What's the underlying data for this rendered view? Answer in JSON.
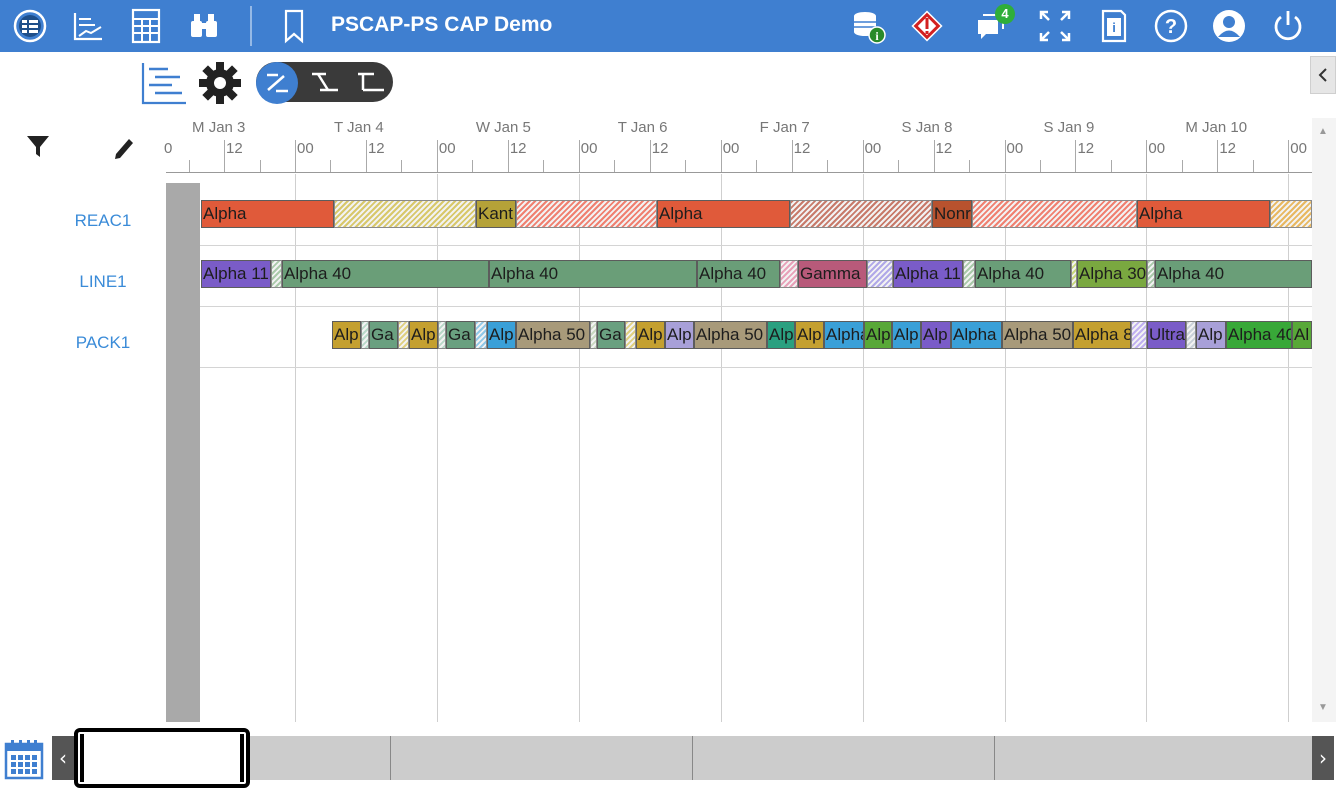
{
  "header": {
    "title": "PSCAP-PS CAP Demo",
    "notification_count": "4",
    "accent_color": "#3f7fd0"
  },
  "toolbar": {
    "icons": [
      "gantt-list-icon",
      "settings-gear-icon",
      "toggle-edit-icon",
      "link-mode-icon",
      "sequence-mode-icon"
    ]
  },
  "left_panel": {
    "filter_icon": "filter-icon",
    "edit_icon": "pencil-icon",
    "rows": [
      "REAC1",
      "LINE1",
      "PACK1"
    ]
  },
  "timeline": {
    "days": [
      "M Jan 3",
      "T Jan 4",
      "W Jan 5",
      "T Jan 6",
      "F Jan 7",
      "S Jan 8",
      "S Jan 9",
      "M Jan 10"
    ],
    "hour_labels": [
      "0",
      "12",
      "00",
      "12",
      "00",
      "12",
      "00",
      "12",
      "00",
      "12",
      "00",
      "12",
      "00",
      "12",
      "00",
      "12",
      "00"
    ]
  },
  "gantt": {
    "REAC1": [
      {
        "label": "Alpha",
        "color": "#e05a3a",
        "hatch": false
      },
      {
        "label": "",
        "color": "#d8c86a",
        "hatch": true
      },
      {
        "label": "Kant",
        "color": "#b5a238",
        "hatch": false
      },
      {
        "label": "",
        "color": "#f08070",
        "hatch": true
      },
      {
        "label": "Alpha",
        "color": "#e05a3a",
        "hatch": false
      },
      {
        "label": "",
        "color": "#c87a6a",
        "hatch": true
      },
      {
        "label": "Nonr",
        "color": "#b8522e",
        "hatch": false
      },
      {
        "label": "",
        "color": "#f08070",
        "hatch": true
      },
      {
        "label": "Alpha",
        "color": "#e05a3a",
        "hatch": false
      },
      {
        "label": "",
        "color": "#e8b860",
        "hatch": true
      }
    ],
    "LINE1": [
      {
        "label": "Alpha 11",
        "color": "#7a5cc8",
        "hatch": false
      },
      {
        "label": "",
        "color": "#a9c9a9",
        "hatch": true
      },
      {
        "label": "Alpha 40",
        "color": "#6a9e78",
        "hatch": false
      },
      {
        "label": "Alpha 40",
        "color": "#6a9e78",
        "hatch": false
      },
      {
        "label": "Alpha 40",
        "color": "#6a9e78",
        "hatch": false
      },
      {
        "label": "",
        "color": "#e8a0b8",
        "hatch": true
      },
      {
        "label": "Gamma",
        "color": "#b85a7a",
        "hatch": false
      },
      {
        "label": "",
        "color": "#b0a8e8",
        "hatch": true
      },
      {
        "label": "Alpha 11",
        "color": "#7a5cc8",
        "hatch": false
      },
      {
        "label": "",
        "color": "#a9c9a9",
        "hatch": true
      },
      {
        "label": "Alpha 40",
        "color": "#6a9e78",
        "hatch": false
      },
      {
        "label": "",
        "color": "#c8d87a",
        "hatch": true
      },
      {
        "label": "Alpha 30",
        "color": "#7aa840",
        "hatch": false
      },
      {
        "label": "",
        "color": "#a9c9a9",
        "hatch": true
      },
      {
        "label": "Alpha 40",
        "color": "#6a9e78",
        "hatch": false
      }
    ],
    "PACK1": [
      {
        "label": "Alp",
        "color": "#c4a030",
        "hatch": false
      },
      {
        "label": "",
        "color": "#b8d8c8",
        "hatch": true
      },
      {
        "label": "Ga",
        "color": "#6aa080",
        "hatch": false
      },
      {
        "label": "",
        "color": "#e0d080",
        "hatch": true
      },
      {
        "label": "Alp",
        "color": "#c4a030",
        "hatch": false
      },
      {
        "label": "",
        "color": "#b8d8c8",
        "hatch": true
      },
      {
        "label": "Ga",
        "color": "#6aa080",
        "hatch": false
      },
      {
        "label": "",
        "color": "#90c8e8",
        "hatch": true
      },
      {
        "label": "Alp",
        "color": "#3aa0d8",
        "hatch": false
      },
      {
        "label": "Alpha 50",
        "color": "#a89a7a",
        "hatch": false
      },
      {
        "label": "",
        "color": "#c8d8c0",
        "hatch": true
      },
      {
        "label": "Ga",
        "color": "#6aa080",
        "hatch": false
      },
      {
        "label": "",
        "color": "#e0d080",
        "hatch": true
      },
      {
        "label": "Alp",
        "color": "#c4a030",
        "hatch": false
      },
      {
        "label": "Alp",
        "color": "#a8a0d8",
        "hatch": false
      },
      {
        "label": "Alpha 50",
        "color": "#a89a7a",
        "hatch": false
      },
      {
        "label": "Alp",
        "color": "#2aa080",
        "hatch": false
      },
      {
        "label": "Alp",
        "color": "#c4a030",
        "hatch": false
      },
      {
        "label": "Alpha",
        "color": "#3aa0d8",
        "hatch": false
      },
      {
        "label": "Alp",
        "color": "#58a838",
        "hatch": false
      },
      {
        "label": "Alp",
        "color": "#3aa0d8",
        "hatch": false
      },
      {
        "label": "Alp",
        "color": "#7a5cc8",
        "hatch": false
      },
      {
        "label": "Alpha",
        "color": "#3aa0d8",
        "hatch": false
      },
      {
        "label": "Alpha 50",
        "color": "#a89a7a",
        "hatch": false
      },
      {
        "label": "Alpha 8",
        "color": "#c4a030",
        "hatch": false
      },
      {
        "label": "",
        "color": "#c0b0f0",
        "hatch": true
      },
      {
        "label": "Ultra",
        "color": "#7a5cc8",
        "hatch": false
      },
      {
        "label": "",
        "color": "#c8d0d8",
        "hatch": true
      },
      {
        "label": "Alp",
        "color": "#a8a0d8",
        "hatch": false
      },
      {
        "label": "Alpha 40",
        "color": "#38a838",
        "hatch": false
      },
      {
        "label": "Al",
        "color": "#58a838",
        "hatch": false
      }
    ]
  },
  "bottom": {
    "calendar_icon": "calendar-icon",
    "prev_icon": "chevron-left-icon",
    "next_icon": "chevron-right-icon"
  }
}
